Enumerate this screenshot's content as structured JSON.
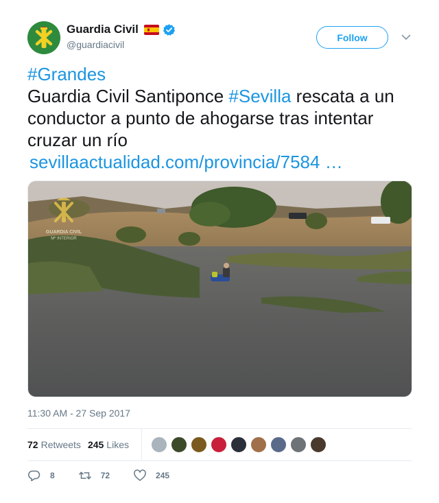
{
  "header": {
    "display_name": "Guardia Civil",
    "handle": "@guardiacivil",
    "follow_label": "Follow",
    "verified": true
  },
  "tweet": {
    "hashtag1": "#Grandes",
    "text_part1": "Guardia Civil Santiponce ",
    "hashtag2": "#Sevilla",
    "text_part2": " rescata a un conductor a punto de ahogarse tras intentar cruzar un río",
    "link": "sevillaactualidad.com/provincia/7584  …"
  },
  "media": {
    "watermark_line1": "GUARDIA CIVIL",
    "watermark_line2": "Mº INTERIOR"
  },
  "timestamp": "11:30 AM - 27 Sep 2017",
  "stats": {
    "retweets_count": "72",
    "retweets_label": "Retweets",
    "likes_count": "245",
    "likes_label": "Likes"
  },
  "actions": {
    "reply_count": "8",
    "retweet_count": "72",
    "like_count": "245"
  },
  "colors": {
    "accent": "#1da1f2",
    "link": "#1b95e0",
    "secondary_text": "#657786"
  }
}
